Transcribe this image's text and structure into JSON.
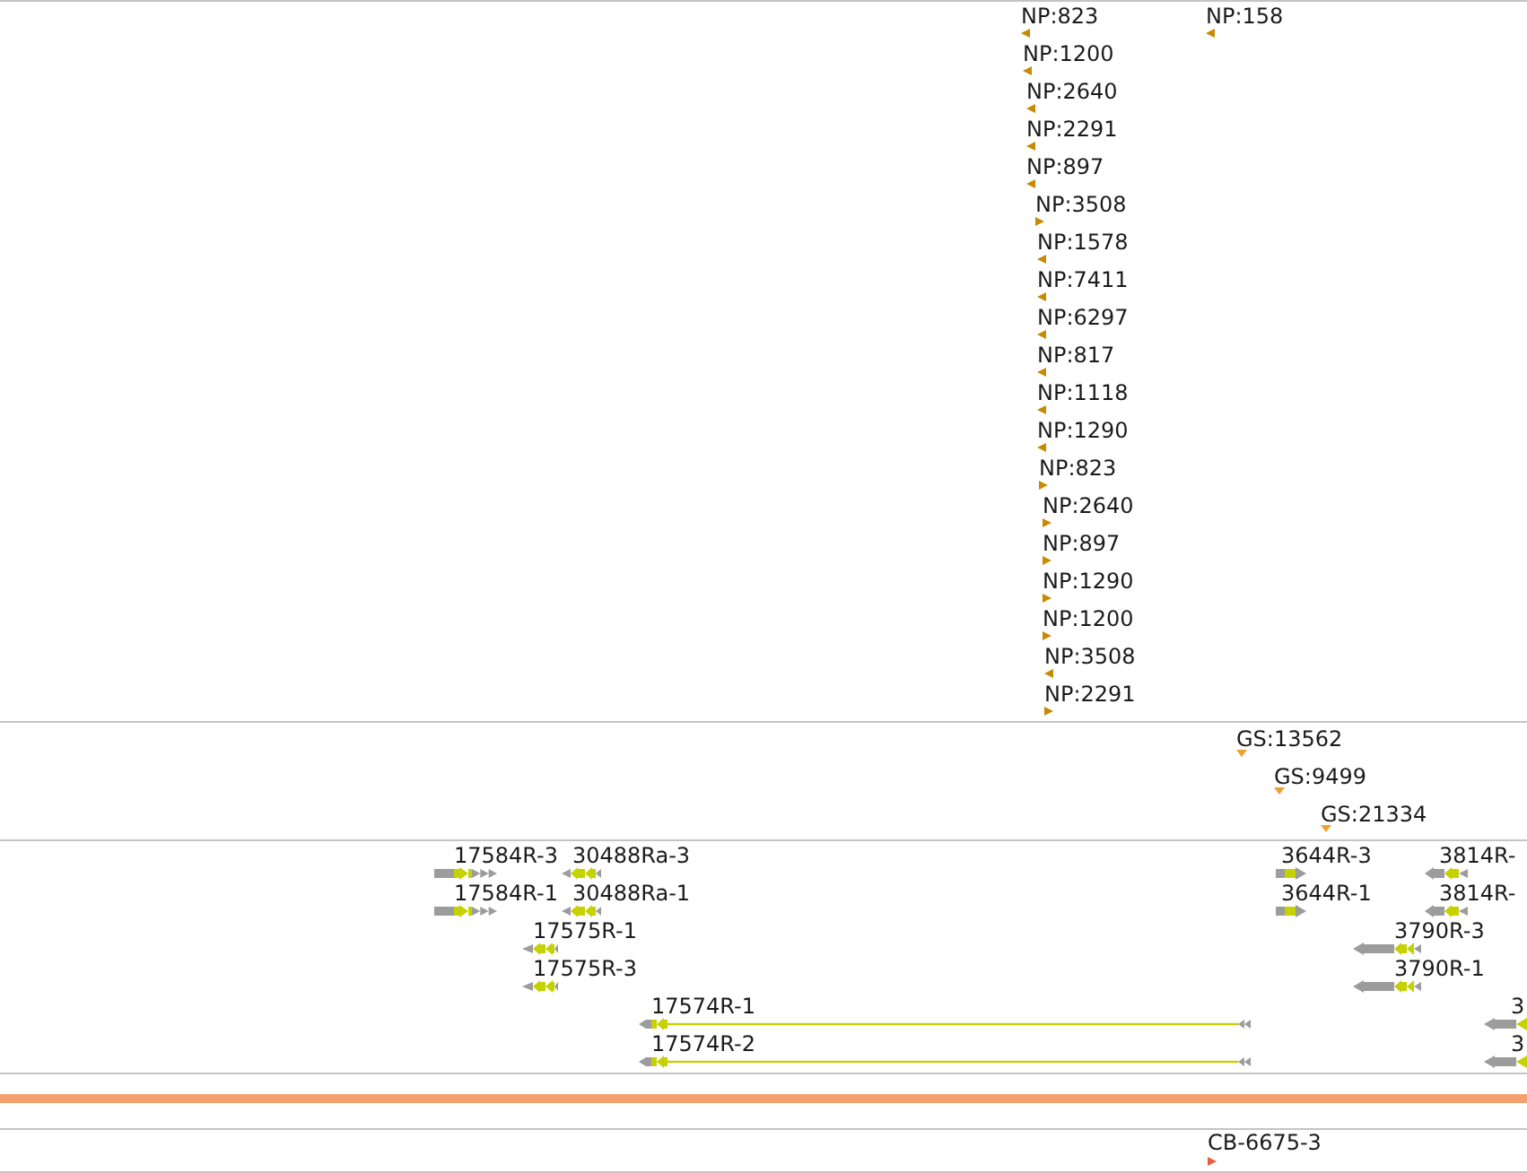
{
  "tracks": [
    {
      "kind": "markers",
      "color": "#c88a00",
      "features": [
        {
          "label": "NP:823",
          "reverse": true
        },
        {
          "label": "NP:158",
          "reverse": true
        },
        {
          "label": "NP:1200",
          "reverse": true
        },
        {
          "label": "NP:2640",
          "reverse": true
        },
        {
          "label": "NP:2291",
          "reverse": true
        },
        {
          "label": "NP:897",
          "reverse": true
        },
        {
          "label": "NP:3508",
          "reverse": false
        },
        {
          "label": "NP:1578",
          "reverse": true
        },
        {
          "label": "NP:7411",
          "reverse": true
        },
        {
          "label": "NP:6297",
          "reverse": true
        },
        {
          "label": "NP:817",
          "reverse": true
        },
        {
          "label": "NP:1118",
          "reverse": true
        },
        {
          "label": "NP:1290",
          "reverse": true
        },
        {
          "label": "NP:823",
          "reverse": false
        },
        {
          "label": "NP:2640",
          "reverse": false
        },
        {
          "label": "NP:897",
          "reverse": false
        },
        {
          "label": "NP:1290",
          "reverse": false
        },
        {
          "label": "NP:1200",
          "reverse": false
        },
        {
          "label": "NP:3508",
          "reverse": true
        },
        {
          "label": "NP:2291",
          "reverse": false
        }
      ]
    },
    {
      "kind": "markers",
      "color": "#f0a030",
      "features": [
        {
          "label": "GS:13562"
        },
        {
          "label": "GS:9499"
        },
        {
          "label": "GS:21334"
        }
      ]
    },
    {
      "kind": "transcripts",
      "features": [
        {
          "label": "17584R-3",
          "reverse": false
        },
        {
          "label": "30488Ra-3",
          "reverse": true
        },
        {
          "label": "3644R-3",
          "reverse": false
        },
        {
          "label": "3814R-",
          "reverse": true
        },
        {
          "label": "17584R-1",
          "reverse": false
        },
        {
          "label": "30488Ra-1",
          "reverse": true
        },
        {
          "label": "3644R-1",
          "reverse": false
        },
        {
          "label": "3814R-",
          "reverse": true
        },
        {
          "label": "17575R-1",
          "reverse": true
        },
        {
          "label": "3790R-3",
          "reverse": true
        },
        {
          "label": "17575R-3",
          "reverse": true
        },
        {
          "label": "3790R-1",
          "reverse": true
        },
        {
          "label": "17574R-1",
          "reverse": true
        },
        {
          "label": "3",
          "reverse": true
        },
        {
          "label": "17574R-2",
          "reverse": true
        },
        {
          "label": "3",
          "reverse": true
        }
      ]
    },
    {
      "kind": "band"
    },
    {
      "kind": "markers",
      "color": "#f05a3c",
      "features": [
        {
          "label": "CB-6675-3",
          "reverse": false
        }
      ]
    }
  ]
}
